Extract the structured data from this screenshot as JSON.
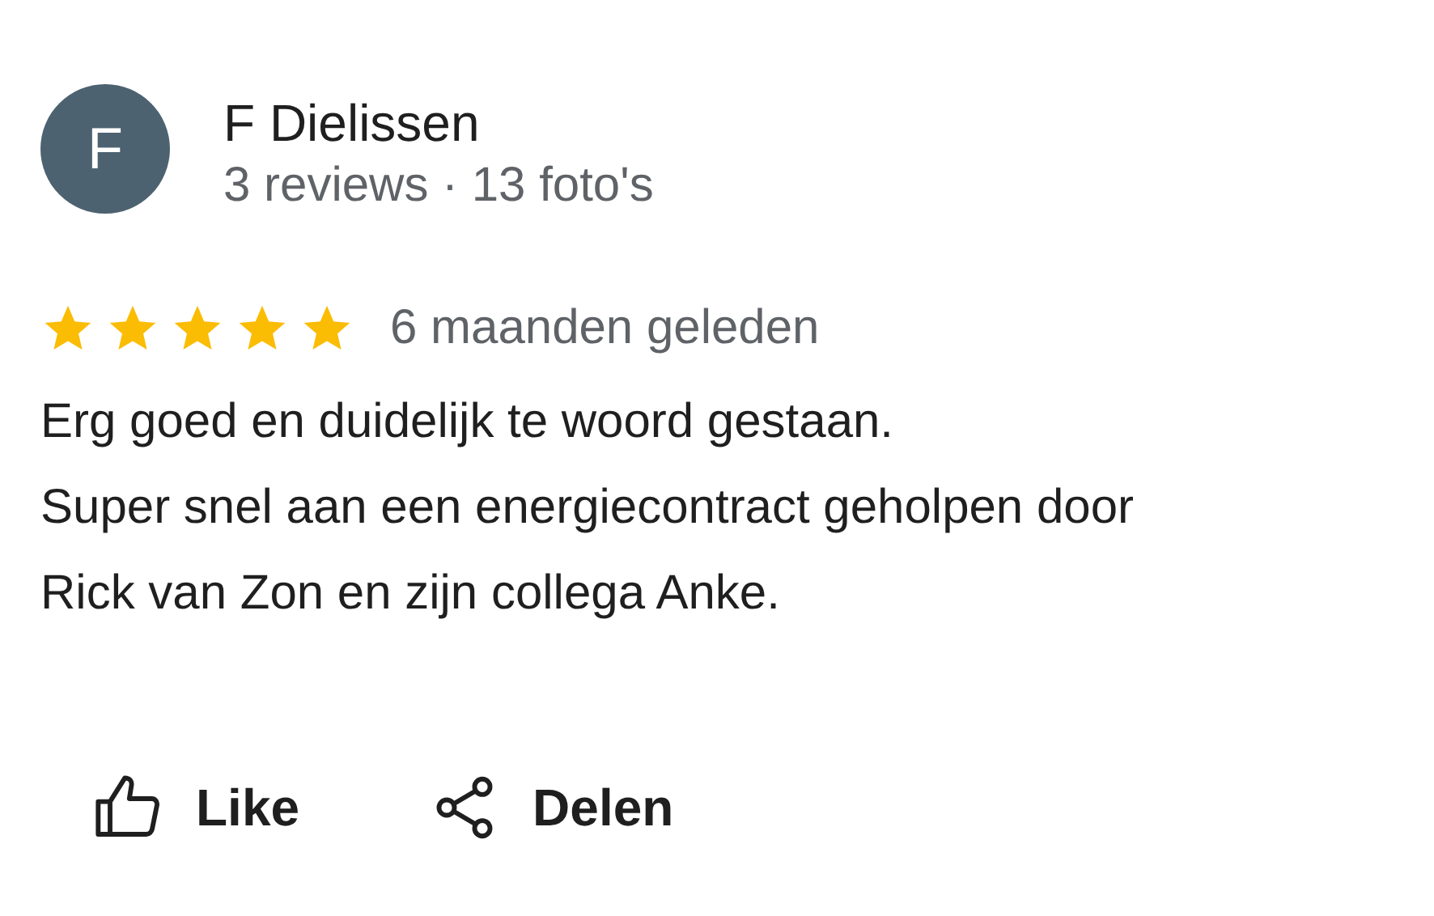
{
  "review": {
    "avatar_letter": "F",
    "author": "F Dielissen",
    "author_meta": "3 reviews · 13 foto's",
    "stars": 5,
    "time": "6 maanden geleden",
    "text_lines": [
      "Erg goed en duidelijk te woord gestaan.",
      "Super snel aan een energiecontract geholpen door",
      "Rick van Zon en zijn collega Anke."
    ]
  },
  "actions": [
    {
      "kind": "like",
      "label": "Like"
    },
    {
      "kind": "share",
      "label": "Delen"
    }
  ]
}
